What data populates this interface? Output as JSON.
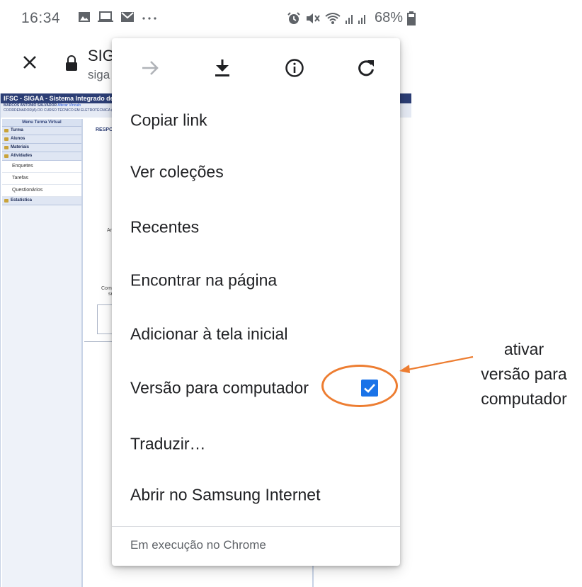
{
  "status_bar": {
    "time": "16:34",
    "battery": "68%",
    "icons": [
      "gallery-icon",
      "laptop-icon",
      "mail-icon",
      "more-icon",
      "alarm-icon",
      "mute-icon",
      "wifi-icon",
      "signal-icon",
      "battery-icon"
    ]
  },
  "toolbar": {
    "title": "SIG",
    "host": "siga"
  },
  "webpage": {
    "header": "IFSC - SIGAA -  Sistema Integrado de G",
    "user": "MARCOS ANTONIO SALVADOR",
    "user_link": "Alterar Vínculo",
    "coordination": "COORDENADOR(A) DO CURSO TÉCNICO EM ELETROTÉCNICA (CAMPUS",
    "menu_title": "Menu Turma Virtual",
    "menu_items": [
      "Turma",
      "Alunos",
      "Materiais",
      "Atividades"
    ],
    "menu_subitems": [
      "Enquetes",
      "Tarefas",
      "Questionários"
    ],
    "menu_stats": "Estatística",
    "content_title": "RESPO",
    "frag_an": "An",
    "frag_come": "Come",
    "frag_se": "se"
  },
  "menu": {
    "items": [
      {
        "label": "Copiar link"
      },
      {
        "label": "Ver coleções"
      },
      {
        "label": "Recentes"
      },
      {
        "label": "Encontrar na página"
      },
      {
        "label": "Adicionar à tela inicial"
      },
      {
        "label": "Versão para computador",
        "checked": true
      },
      {
        "label": "Traduzir…"
      },
      {
        "label": "Abrir no Samsung Internet"
      }
    ],
    "footer": "Em execução no Chrome"
  },
  "annotation": {
    "line1": "ativar",
    "line2": "versão para",
    "line3": "computador"
  },
  "colors": {
    "accent": "#1a73e8",
    "annotation": "#ed7d31",
    "site_header": "#2c3e75"
  }
}
